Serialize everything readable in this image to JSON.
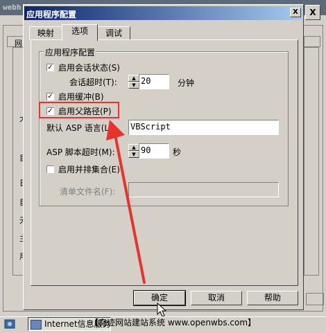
{
  "background": {
    "title_fragment": "webh",
    "tab_fragment": "网",
    "close_glyph": "X",
    "side_chars": [
      "大",
      "目",
      "日",
      "目",
      "无",
      "主",
      "用"
    ]
  },
  "dialog": {
    "title": "应用程序配置",
    "close_glyph": "X",
    "tabs": [
      {
        "label": "映射",
        "selected": false
      },
      {
        "label": "选项",
        "selected": true
      },
      {
        "label": "调试",
        "selected": false
      }
    ],
    "group_title": "应用程序配置",
    "options": {
      "session_state": {
        "label": "启用会话状态(S)",
        "checked": true
      },
      "session_timeout": {
        "label": "会话超时(T):",
        "value": "20",
        "unit": "分钟"
      },
      "buffering": {
        "label": "启用缓冲(B)",
        "checked": true
      },
      "parent_paths": {
        "label": "启用父路径(P)",
        "checked": true
      },
      "default_language": {
        "label": "默认 ASP 语言(L):",
        "value": "VBScript"
      },
      "script_timeout": {
        "label": "ASP 脚本超时(M):",
        "value": "90",
        "unit": "秒"
      },
      "side_by_side": {
        "label": "启用并排集合(E)",
        "checked": false
      },
      "manifest": {
        "label": "清单文件名(F):",
        "value": ""
      }
    },
    "buttons": {
      "ok": "确定",
      "cancel": "取消",
      "help": "帮助"
    }
  },
  "taskbar": {
    "task1": "Internet",
    "task2": "信息服务",
    "watermark": "【奇迹网站建站系统 www.openwbs.com】"
  },
  "colors": {
    "highlight": "#e8322e",
    "title_start": "#0a246a",
    "title_end": "#a6caf0"
  }
}
